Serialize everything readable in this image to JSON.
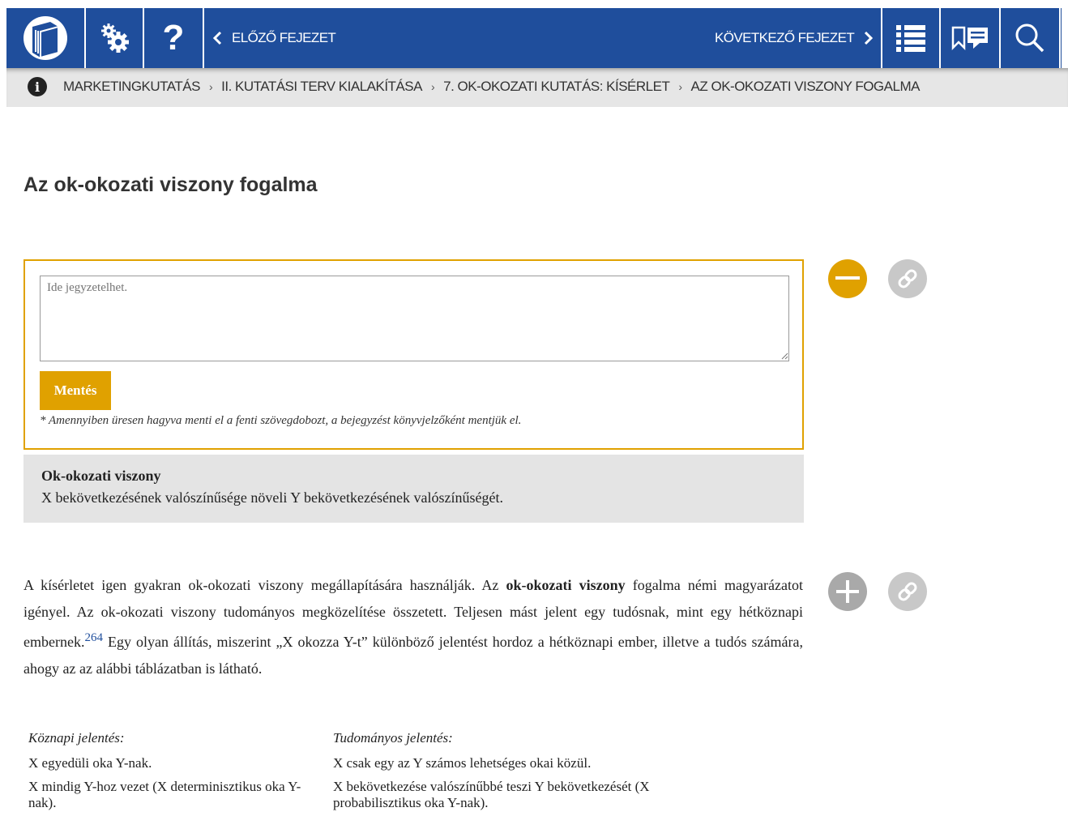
{
  "topbar": {
    "prev_label": "ELŐZŐ FEJEZET",
    "next_label": "KÖVETKEZŐ FEJEZET",
    "help_glyph": "?",
    "colors": {
      "bar": "#1f4e9c",
      "accent": "#e0a100"
    },
    "icons": [
      "book-logo-icon",
      "settings-icon",
      "help-icon",
      "chevron-left-icon",
      "chevron-right-icon",
      "toc-list-icon",
      "bookmark-note-icon",
      "search-icon"
    ]
  },
  "breadcrumb": {
    "items": [
      "MARKETINGKUTATÁS",
      "II. KUTATÁSI TERV KIALAKÍTÁSA",
      "7. OK-OKOZATI KUTATÁS: KÍSÉRLET",
      "AZ OK-OKOZATI VISZONY FOGALMA"
    ],
    "separator": "›"
  },
  "page": {
    "title": "Az ok-okozati viszony fogalma"
  },
  "note": {
    "placeholder": "Ide jegyzetelhet.",
    "save_label": "Mentés",
    "hint": "* Amennyiben üresen hagyva menti el a fenti szövegdobozt, a bejegyzést könyvjelzőként mentjük el."
  },
  "definition": {
    "title": "Ok-okozati viszony",
    "text": "X bekövetkezésének valószínűsége növeli Y bekövetkezésének valószínűségét."
  },
  "paragraph": {
    "part1": "A kísérletet igen gyakran ok-okozati viszony megállapítására használják. Az ",
    "bold": "ok-okozati viszony",
    "part2": " fogalma némi magyarázatot igényel. Az ok-okozati viszony tudományos megközelítése összetett. Teljesen mást jelent egy tudósnak, mint egy hétköznapi embernek.",
    "footnote": "264",
    "part3": " Egy olyan állítás, miszerint „X okozza Y-t” különböző jelentést hordoz a hétköznapi ember, illetve a tudós számára, ahogy az az alábbi táblázatban is látható."
  },
  "table": {
    "headers": [
      "Köznapi jelentés:",
      "Tudományos jelentés:"
    ],
    "rows": [
      [
        "X egyedüli oka Y-nak.",
        "X csak egy az Y számos lehetséges okai közül."
      ],
      [
        "X mindig Y-hoz vezet (X determinisztikus oka Y-nak).",
        "X bekövetkezése valószínűbbé teszi Y bekövetkezését (X probabilisztikus oka Y-nak)."
      ]
    ]
  }
}
